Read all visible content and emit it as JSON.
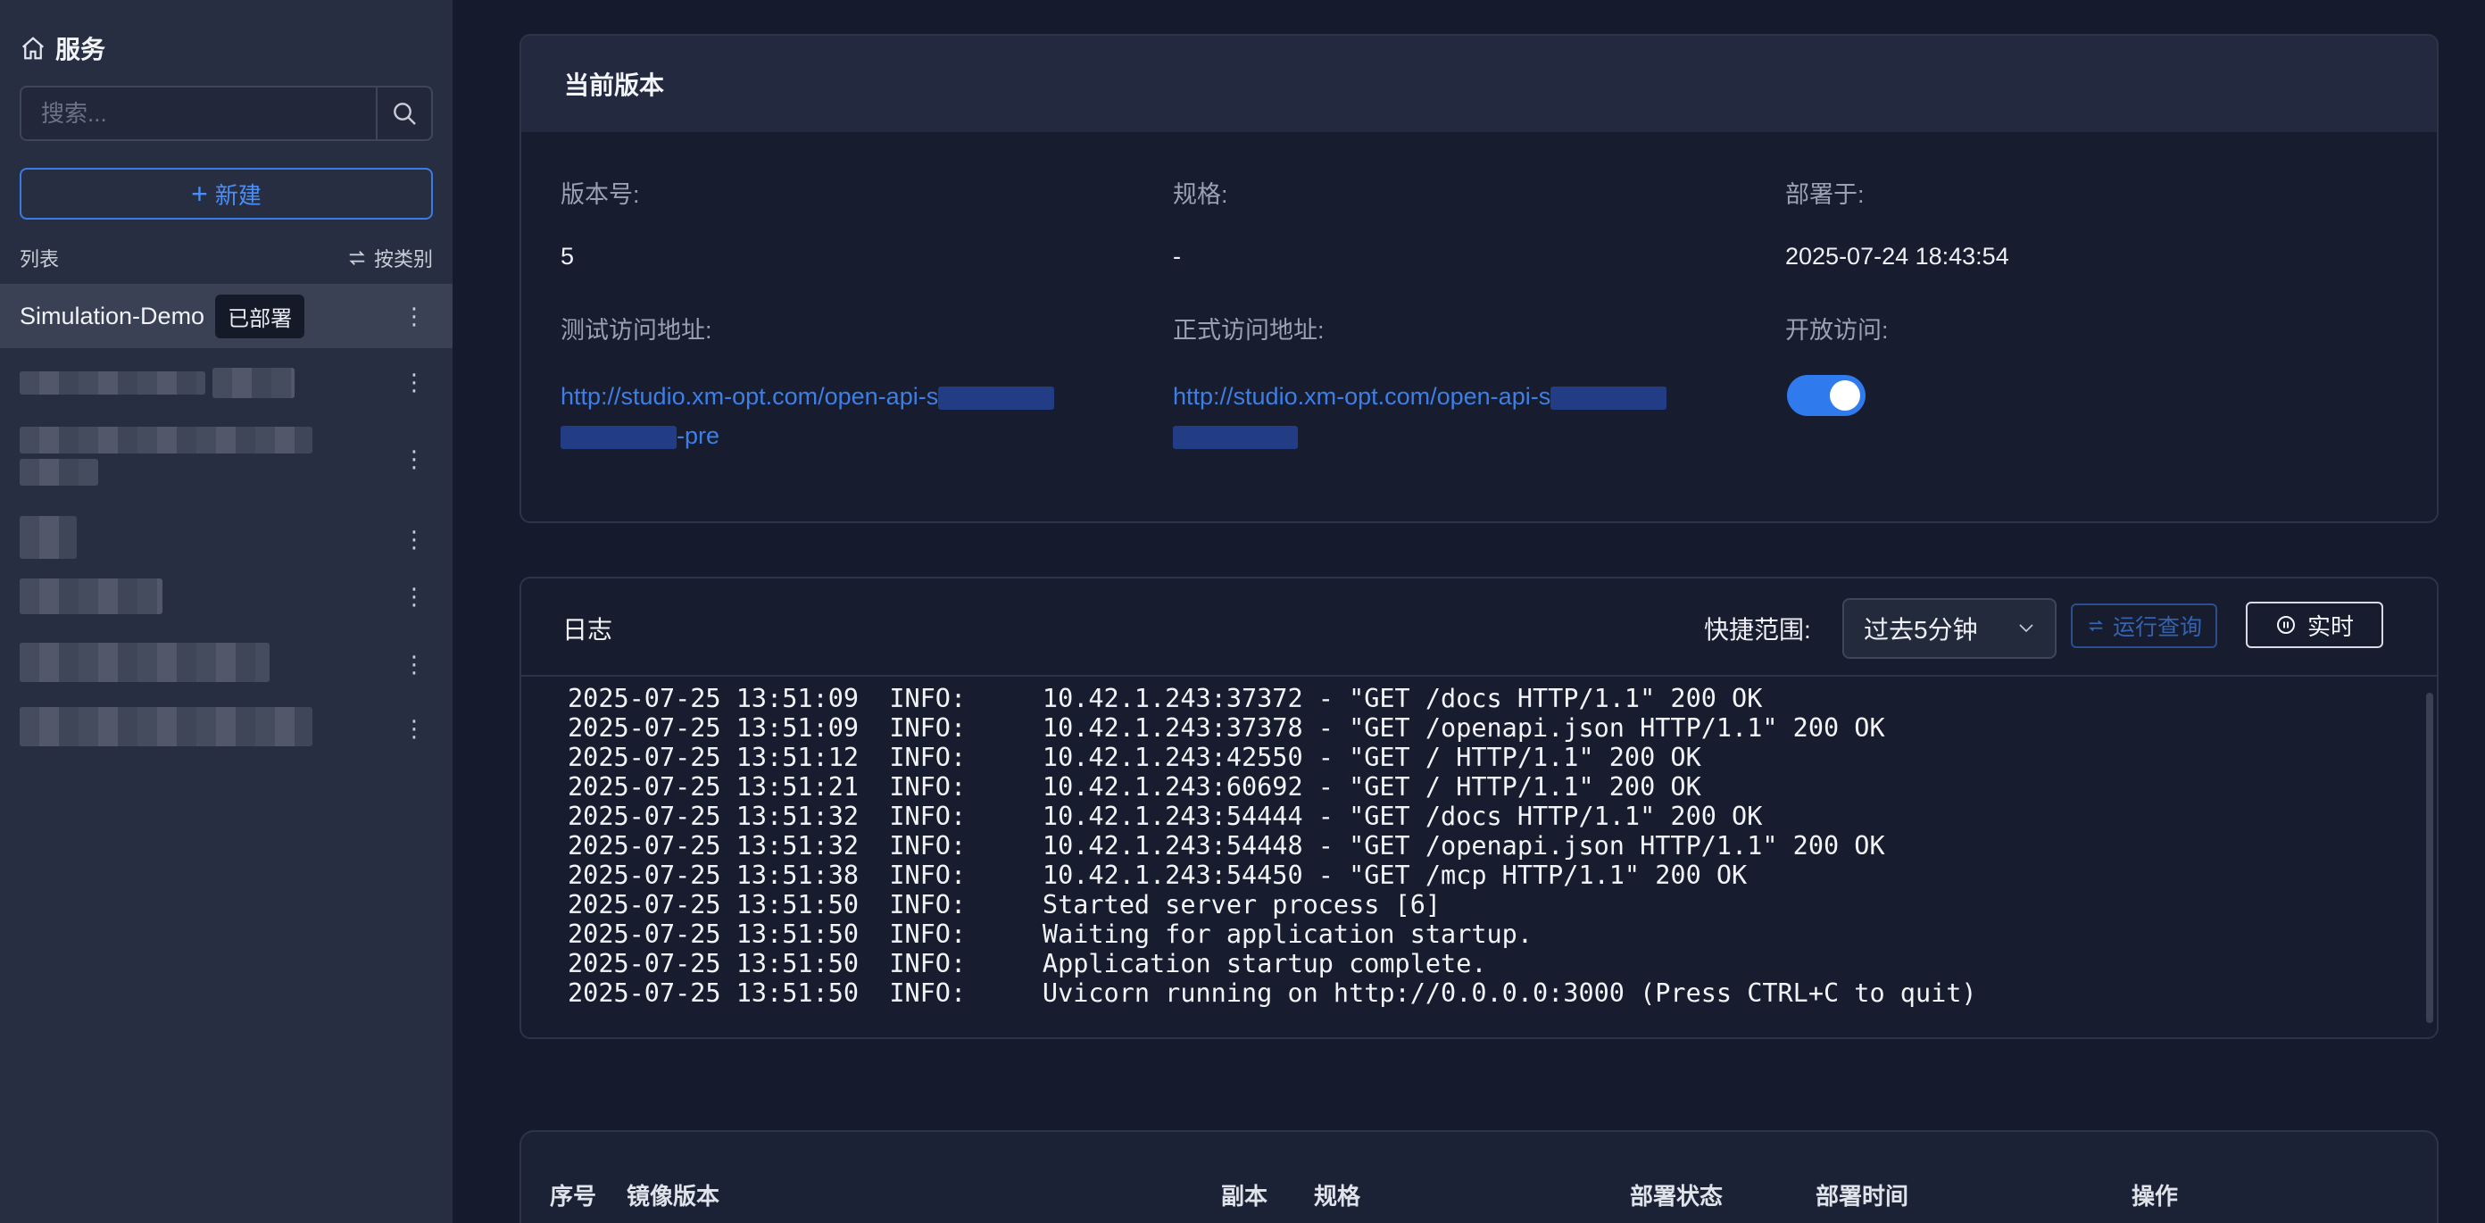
{
  "sidebar": {
    "title": "服务",
    "search_placeholder": "搜索...",
    "new_label": "新建",
    "list_label": "列表",
    "sort_label": "按类别",
    "items": [
      {
        "name": "Simulation-Demo",
        "badge": "已部署"
      }
    ]
  },
  "current_version": {
    "title": "当前版本",
    "version_label": "版本号:",
    "version_value": "5",
    "spec_label": "规格:",
    "spec_value": "-",
    "deployed_label": "部署于:",
    "deployed_value": "2025-07-24 18:43:54",
    "test_url_label": "测试访问地址:",
    "test_url_prefix": "http://studio.xm-opt.com/open-api-s",
    "test_url_suffix": "-pre",
    "prod_url_label": "正式访问地址:",
    "prod_url_prefix": "http://studio.xm-opt.com/open-api-s",
    "open_access_label": "开放访问:",
    "open_access_enabled": true
  },
  "logs": {
    "title": "日志",
    "range_label": "快捷范围:",
    "range_value": "过去5分钟",
    "run_query_label": "运行查询",
    "live_label": "实时",
    "lines": [
      "2025-07-25 13:51:09  INFO:     10.42.1.243:37372 - \"GET /docs HTTP/1.1\" 200 OK",
      "2025-07-25 13:51:09  INFO:     10.42.1.243:37378 - \"GET /openapi.json HTTP/1.1\" 200 OK",
      "2025-07-25 13:51:12  INFO:     10.42.1.243:42550 - \"GET / HTTP/1.1\" 200 OK",
      "2025-07-25 13:51:21  INFO:     10.42.1.243:60692 - \"GET / HTTP/1.1\" 200 OK",
      "2025-07-25 13:51:32  INFO:     10.42.1.243:54444 - \"GET /docs HTTP/1.1\" 200 OK",
      "2025-07-25 13:51:32  INFO:     10.42.1.243:54448 - \"GET /openapi.json HTTP/1.1\" 200 OK",
      "2025-07-25 13:51:38  INFO:     10.42.1.243:54450 - \"GET /mcp HTTP/1.1\" 200 OK",
      "2025-07-25 13:51:50  INFO:     Started server process [6]",
      "2025-07-25 13:51:50  INFO:     Waiting for application startup.",
      "2025-07-25 13:51:50  INFO:     Application startup complete.",
      "2025-07-25 13:51:50  INFO:     Uvicorn running on http://0.0.0.0:3000 (Press CTRL+C to quit)"
    ]
  },
  "table": {
    "columns": [
      "序号",
      "镜像版本",
      "副本",
      "规格",
      "部署状态",
      "部署时间",
      "操作"
    ]
  },
  "colors": {
    "accent": "#3a7be8",
    "background": "#151a2c",
    "sidebar": "#272e41",
    "panel": "#171c2e"
  }
}
